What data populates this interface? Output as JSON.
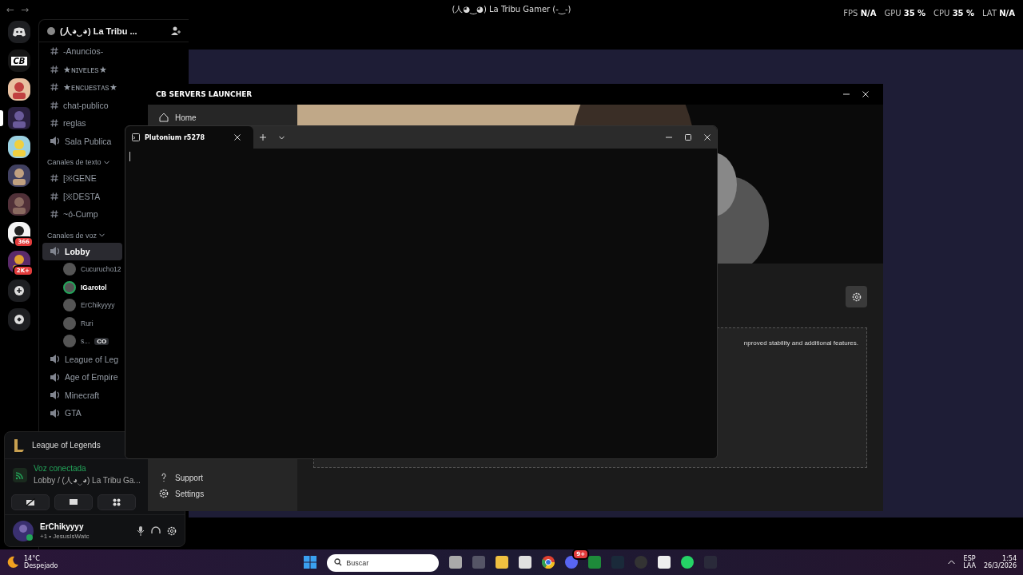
{
  "title_bar": {
    "back": "←",
    "forward": "→",
    "title": "(人◕‿◕) La Tribu Gamer (-‿-)"
  },
  "overlay": [
    {
      "label": "FPS",
      "value": "N/A"
    },
    {
      "label": "GPU",
      "value": "35 %"
    },
    {
      "label": "CPU",
      "value": "35 %"
    },
    {
      "label": "LAT",
      "value": "N/A"
    }
  ],
  "servers": [
    {
      "kind": "home",
      "selected": false
    },
    {
      "kind": "logo",
      "label": "CB",
      "selected": false
    },
    {
      "kind": "picture",
      "selected": false
    },
    {
      "kind": "picture",
      "selected": true
    },
    {
      "kind": "picture",
      "selected": false
    },
    {
      "kind": "picture",
      "selected": false
    },
    {
      "kind": "picture",
      "selected": false
    },
    {
      "kind": "picture",
      "selected": false,
      "badge": "366"
    },
    {
      "kind": "picture",
      "selected": false,
      "badge": "2K+"
    },
    {
      "kind": "add",
      "selected": false
    },
    {
      "kind": "explore",
      "selected": false
    }
  ],
  "server": {
    "name": "(人◕‿◕) La Tribu ..."
  },
  "channels": [
    {
      "kind": "text",
      "name": "-Anuncios-",
      "selected": false
    },
    {
      "kind": "text",
      "name": "★ɴɪᴠᴇʟᴇs★",
      "selected": false
    },
    {
      "kind": "text",
      "name": "★ᴇɴᴄᴜᴇsᴛᴀs★",
      "selected": false
    },
    {
      "kind": "text",
      "name": "chat-publico",
      "selected": false
    },
    {
      "kind": "text",
      "name": "reglas",
      "selected": false
    },
    {
      "kind": "voice",
      "name": "Sala Publica",
      "selected": false
    },
    {
      "kind": "category",
      "name": "Canales de texto"
    },
    {
      "kind": "text",
      "name": "[※GENE",
      "selected": false
    },
    {
      "kind": "text",
      "name": "[※DESTA",
      "selected": false
    },
    {
      "kind": "text",
      "name": "~ó-Cump",
      "selected": false
    },
    {
      "kind": "category",
      "name": "Canales de voz"
    },
    {
      "kind": "voice",
      "name": "Lobby",
      "selected": true
    },
    {
      "kind": "member",
      "name": "Cucurucho12",
      "speaking": false
    },
    {
      "kind": "member",
      "name": "IGarotol",
      "speaking": true
    },
    {
      "kind": "member",
      "name": "ErChikyyyy",
      "speaking": false
    },
    {
      "kind": "member",
      "name": "Ruri",
      "speaking": false
    },
    {
      "kind": "member",
      "name": "s...",
      "tag": "CO",
      "speaking": false
    },
    {
      "kind": "voice",
      "name": "League of Leg",
      "selected": false
    },
    {
      "kind": "voice",
      "name": "Age of Empire",
      "selected": false
    },
    {
      "kind": "voice",
      "name": "Minecraft",
      "selected": false
    },
    {
      "kind": "voice",
      "name": "GTA",
      "selected": false
    }
  ],
  "voice_panel": {
    "activity": "League of Legends",
    "status": "Voz conectada",
    "location": "Lobby / (人◕‿◕) La Tribu Ga...",
    "user": "ErChikyyyy",
    "user_status": "+1 • JesusIsWatc"
  },
  "launcher": {
    "title": "CB SERVERS LAUNCHER",
    "nav": [
      "Home",
      "Support",
      "Settings"
    ],
    "card_text": "nproved stability and additional features."
  },
  "terminal": {
    "tab": "Plutonium r5278"
  },
  "taskbar": {
    "search_placeholder": "Buscar",
    "weather_temp": "14°C",
    "weather_text": "Despejado",
    "discord_badge": "9+",
    "language": "ESP",
    "layout": "LAA",
    "time": "1:54",
    "date": "26/3/2026"
  }
}
